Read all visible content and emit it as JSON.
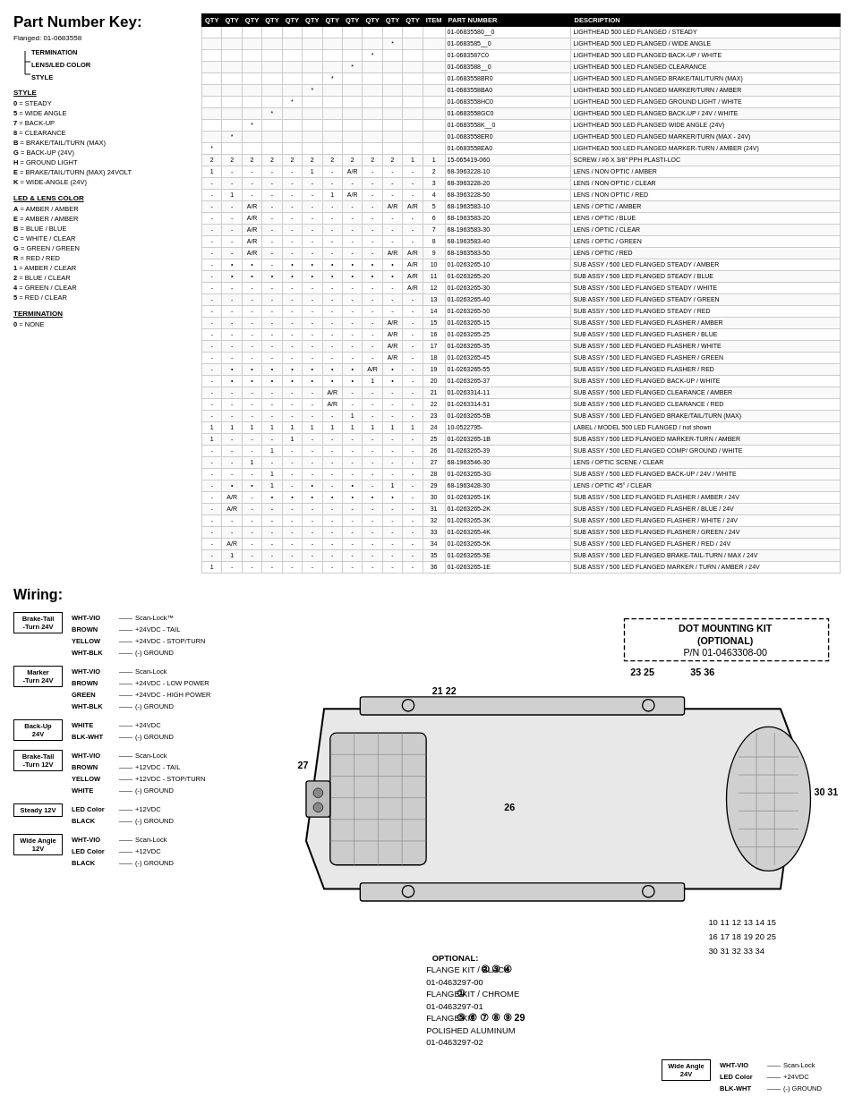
{
  "title": "Part Number Key:",
  "flanged_label": "Flanged:",
  "flanged_pn": "01-0683558",
  "diagram": {
    "termination_label": "TERMINATION",
    "lens_color_label": "LENS/LED COLOR",
    "style_label": "STYLE"
  },
  "style_section": {
    "title": "STYLE",
    "items": [
      {
        "code": "0",
        "desc": "STEADY"
      },
      {
        "code": "5",
        "desc": "WIDE ANGLE"
      },
      {
        "code": "7",
        "desc": "BACK-UP"
      },
      {
        "code": "8",
        "desc": "CLEARANCE"
      },
      {
        "code": "B",
        "desc": "BRAKE/TAIL/TURN (MAX)"
      },
      {
        "code": "G",
        "desc": "BACK-UP (24V)"
      },
      {
        "code": "H",
        "desc": "GROUND LIGHT"
      },
      {
        "code": "E",
        "desc": "BRAKE/TAIL/TURN (MAX) 24VOLT"
      },
      {
        "code": "K",
        "desc": "WIDE-ANGLE (24V)"
      }
    ]
  },
  "led_lens_section": {
    "title": "LED & LENS COLOR",
    "items": [
      {
        "code": "A",
        "desc": "AMBER / AMBER"
      },
      {
        "code": "E",
        "desc": "AMBER / AMBER"
      },
      {
        "code": "B",
        "desc": "BLUE / BLUE"
      },
      {
        "code": "C",
        "desc": "WHITE / CLEAR"
      },
      {
        "code": "G",
        "desc": "GREEN / GREEN"
      },
      {
        "code": "R",
        "desc": "RED / RED"
      },
      {
        "code": "1",
        "desc": "AMBER / CLEAR"
      },
      {
        "code": "2",
        "desc": "BLUE / CLEAR"
      },
      {
        "code": "4",
        "desc": "GREEN / CLEAR"
      },
      {
        "code": "5",
        "desc": "RED / CLEAR"
      }
    ]
  },
  "termination_section": {
    "title": "TERMINATION",
    "items": [
      {
        "code": "0",
        "desc": "NONE"
      }
    ]
  },
  "table": {
    "headers": [
      "QTY",
      "QTY",
      "QTY",
      "QTY",
      "QTY",
      "QTY",
      "QTY",
      "QTY",
      "QTY",
      "QTY",
      "QTY",
      "ITEM",
      "PART NUMBER",
      "DESCRIPTION"
    ],
    "rows": [
      [
        "",
        "",
        "",
        "",
        "",
        "",
        "",
        "",
        "",
        "",
        "",
        "",
        "01-06835580__0",
        "LIGHTHEAD 500 LED FLANGED / STEADY"
      ],
      [
        "",
        "",
        "",
        "",
        "",
        "",
        "",
        "",
        "",
        "*",
        "",
        "",
        "01-0683585__0",
        "LIGHTHEAD 500 LED FLANGED / WIDE ANGLE"
      ],
      [
        "",
        "",
        "",
        "",
        "",
        "",
        "",
        "",
        "*",
        "",
        "",
        "",
        "01-0683587C0",
        "LIGHTHEAD 500 LED FLANGED BACK-UP / WHITE"
      ],
      [
        "",
        "",
        "",
        "",
        "",
        "",
        "",
        "*",
        "",
        "",
        "",
        "",
        "01-0683588__0",
        "LIGHTHEAD 500 LED FLANGED CLEARANCE"
      ],
      [
        "",
        "",
        "",
        "",
        "",
        "",
        "*",
        "",
        "",
        "",
        "",
        "",
        "01-0683558BR0",
        "LIGHTHEAD 500 LED FLANGED BRAKE/TAIL/TURN (MAX)"
      ],
      [
        "",
        "",
        "",
        "",
        "",
        "*",
        "",
        "",
        "",
        "",
        "",
        "",
        "01-0683558BA0",
        "LIGHTHEAD 500 LED FLANGED MARKER/TURN / AMBER"
      ],
      [
        "",
        "",
        "",
        "",
        "*",
        "",
        "",
        "",
        "",
        "",
        "",
        "",
        "01-0683558HC0",
        "LIGHTHEAD 500 LED FLANGED GROUND LIGHT / WHITE"
      ],
      [
        "",
        "",
        "",
        "*",
        "",
        "",
        "",
        "",
        "",
        "",
        "",
        "",
        "01-0683558GC0",
        "LIGHTHEAD 500 LED FLANGED BACK-UP / 24V / WHITE"
      ],
      [
        "",
        "",
        "*",
        "",
        "",
        "",
        "",
        "",
        "",
        "",
        "",
        "",
        "01-0683558K__0",
        "LIGHTHEAD 500 LED FLANGED WIDE ANGLE (24V)"
      ],
      [
        "",
        "*",
        "",
        "",
        "",
        "",
        "",
        "",
        "",
        "",
        "",
        "",
        "01-0683558ER0",
        "LIGHTHEAD 500 LED FLANGED MARKER/TURN (MAX - 24V)"
      ],
      [
        "*",
        "",
        "",
        "",
        "",
        "",
        "",
        "",
        "",
        "",
        "",
        "",
        "01-0683558EA0",
        "LIGHTHEAD 500 LED FLANGED MARKER-TURN / AMBER (24V)"
      ],
      [
        "2",
        "2",
        "2",
        "2",
        "2",
        "2",
        "2",
        "2",
        "2",
        "2",
        "1",
        "1",
        "15-065419-060",
        "SCREW / #6 X 3/8\" PPH PLASTI-LOC"
      ],
      [
        "1",
        "-",
        "-",
        "-",
        "-",
        "1",
        "-",
        "A/R",
        "-",
        "-",
        "-",
        "2",
        "68-3963228-10",
        "LENS / NON OPTIC / AMBER"
      ],
      [
        "-",
        "-",
        "-",
        "-",
        "-",
        "-",
        "-",
        "-",
        "-",
        "-",
        "-",
        "3",
        "68-3963228-20",
        "LENS / NON OPTIC / CLEAR"
      ],
      [
        "-",
        "1",
        "-",
        "-",
        "-",
        "-",
        "1",
        "A/R",
        "-",
        "-",
        "-",
        "4",
        "68-3963228-50",
        "LENS / NON OPTIC / RED"
      ],
      [
        "-",
        "-",
        "A/R",
        "-",
        "-",
        "-",
        "-",
        "-",
        "-",
        "A/R",
        "A/R",
        "5",
        "68-1963583-10",
        "LENS / OPTIC / AMBER"
      ],
      [
        "-",
        "-",
        "A/R",
        "-",
        "-",
        "-",
        "-",
        "-",
        "-",
        "-",
        "-",
        "6",
        "68-1963583-20",
        "LENS / OPTIC / BLUE"
      ],
      [
        "-",
        "-",
        "A/R",
        "-",
        "-",
        "-",
        "-",
        "-",
        "-",
        "-",
        "-",
        "7",
        "68-1963583-30",
        "LENS / OPTIC / CLEAR"
      ],
      [
        "-",
        "-",
        "A/R",
        "-",
        "-",
        "-",
        "-",
        "-",
        "-",
        "-",
        "-",
        "8",
        "68-1963583-40",
        "LENS / OPTIC / GREEN"
      ],
      [
        "-",
        "-",
        "A/R",
        "-",
        "-",
        "-",
        "-",
        "-",
        "-",
        "A/R",
        "A/R",
        "9",
        "68-1963583-50",
        "LENS / OPTIC / RED"
      ],
      [
        "-",
        "•",
        "•",
        "-",
        "•",
        "•",
        "•",
        "•",
        "•",
        "•",
        "A/R",
        "10",
        "01-0263265-10",
        "SUB ASSY / 500 LED FLANGED STEADY / AMBER"
      ],
      [
        "-",
        "•",
        "•",
        "•",
        "•",
        "•",
        "•",
        "•",
        "•",
        "•",
        "A/R",
        "11",
        "01-0263265-20",
        "SUB ASSY / 500 LED FLANGED STEADY / BLUE"
      ],
      [
        "-",
        "-",
        "-",
        "-",
        "-",
        "-",
        "-",
        "-",
        "-",
        "-",
        "A/R",
        "12",
        "01-0263265-30",
        "SUB ASSY / 500 LED FLANGED STEADY / WHITE"
      ],
      [
        "-",
        "-",
        "-",
        "-",
        "-",
        "-",
        "-",
        "-",
        "-",
        "-",
        "-",
        "13",
        "01-0263265-40",
        "SUB ASSY / 500 LED FLANGED STEADY / GREEN"
      ],
      [
        "-",
        "-",
        "-",
        "-",
        "-",
        "-",
        "-",
        "-",
        "-",
        "-",
        "-",
        "14",
        "01-0263265-50",
        "SUB ASSY / 500 LED FLANGED STEADY / RED"
      ],
      [
        "-",
        "-",
        "-",
        "-",
        "-",
        "-",
        "-",
        "-",
        "-",
        "A/R",
        "-",
        "15",
        "01-0263265-15",
        "SUB ASSY / 500 LED FLANGED FLASHER / AMBER"
      ],
      [
        "-",
        "-",
        "-",
        "-",
        "-",
        "-",
        "-",
        "-",
        "-",
        "A/R",
        "-",
        "16",
        "01-0263265-25",
        "SUB ASSY / 500 LED FLANGED FLASHER / BLUE"
      ],
      [
        "-",
        "-",
        "-",
        "-",
        "-",
        "-",
        "-",
        "-",
        "-",
        "A/R",
        "-",
        "17",
        "01-0263265-35",
        "SUB ASSY / 500 LED FLANGED FLASHER / WHITE"
      ],
      [
        "-",
        "-",
        "-",
        "-",
        "-",
        "-",
        "-",
        "-",
        "-",
        "A/R",
        "-",
        "18",
        "01-0263265-45",
        "SUB ASSY / 500 LED FLANGED FLASHER / GREEN"
      ],
      [
        "-",
        "•",
        "•",
        "•",
        "•",
        "•",
        "•",
        "•",
        "A/R",
        "•",
        "-",
        "19",
        "01-0263265-55",
        "SUB ASSY / 500 LED FLANGED FLASHER / RED"
      ],
      [
        "-",
        "•",
        "•",
        "•",
        "•",
        "•",
        "•",
        "•",
        "1",
        "•",
        "-",
        "20",
        "01-0263265-37",
        "SUB ASSY / 500 LED FLANGED BACK-UP / WHITE"
      ],
      [
        "-",
        "-",
        "-",
        "-",
        "-",
        "-",
        "A/R",
        "-",
        "-",
        "-",
        "-",
        "21",
        "01-0263314-11",
        "SUB ASSY / 500 LED FLANGED CLEARANCE / AMBER"
      ],
      [
        "-",
        "-",
        "-",
        "-",
        "-",
        "-",
        "A/R",
        "-",
        "-",
        "-",
        "-",
        "22",
        "01-0263314-51",
        "SUB ASSY / 500 LED FLANGED CLEARANCE / RED"
      ],
      [
        "-",
        "-",
        "-",
        "-",
        "-",
        "-",
        "-",
        "1",
        "-",
        "-",
        "-",
        "23",
        "01-0263265-5B",
        "SUB ASSY / 500 LED FLANGED BRAKE/TAIL/TURN (MAX)"
      ],
      [
        "1",
        "1",
        "1",
        "1",
        "1",
        "1",
        "1",
        "1",
        "1",
        "1",
        "1",
        "24",
        "10-0522795-",
        "LABEL / MODEL 500 LED FLANGED / not shown"
      ],
      [
        "1",
        "-",
        "-",
        "-",
        "1",
        "-",
        "-",
        "-",
        "-",
        "-",
        "-",
        "25",
        "01-0263265-1B",
        "SUB ASSY / 500 LED FLANGED MARKER-TURN / AMBER"
      ],
      [
        "-",
        "-",
        "-",
        "1",
        "-",
        "-",
        "-",
        "-",
        "-",
        "-",
        "-",
        "26",
        "01-0263265-39",
        "SUB ASSY / 500 LED FLANGED COMP/ GROUND / WHITE"
      ],
      [
        "-",
        "-",
        "1",
        "-",
        "-",
        "-",
        "-",
        "-",
        "-",
        "-",
        "-",
        "27",
        "68-1963546-30",
        "LENS / OPTIC SCENE / CLEAR"
      ],
      [
        "-",
        "-",
        "-",
        "1",
        "-",
        "-",
        "-",
        "-",
        "-",
        "-",
        "-",
        "28",
        "01-0263265-3G",
        "SUB ASSY / 500 LED FLANGED BACK-UP / 24V / WHITE"
      ],
      [
        "-",
        "•",
        "•",
        "1",
        "-",
        "•",
        "-",
        "•",
        "-",
        "1",
        "-",
        "29",
        "68-1963428-30",
        "LENS / OPTIC 45° / CLEAR"
      ],
      [
        "-",
        "A/R",
        "-",
        "•",
        "•",
        "•",
        "•",
        "•",
        "•",
        "•",
        "-",
        "30",
        "01-0263265-1K",
        "SUB ASSY / 500 LED FLANGED FLASHER / AMBER / 24V"
      ],
      [
        "-",
        "A/R",
        "-",
        "-",
        "-",
        "-",
        "-",
        "-",
        "-",
        "-",
        "-",
        "31",
        "01-0263265-2K",
        "SUB ASSY / 500 LED FLANGED FLASHER / BLUE / 24V"
      ],
      [
        "-",
        "-",
        "-",
        "-",
        "-",
        "-",
        "-",
        "-",
        "-",
        "-",
        "-",
        "32",
        "01-0263265-3K",
        "SUB ASSY / 500 LED FLANGED FLASHER / WHITE / 24V"
      ],
      [
        "-",
        "-",
        "-",
        "-",
        "-",
        "-",
        "-",
        "-",
        "-",
        "-",
        "-",
        "33",
        "01-0263265-4K",
        "SUB ASSY / 500 LED FLANGED FLASHER / GREEN / 24V"
      ],
      [
        "-",
        "A/R",
        "-",
        "-",
        "-",
        "-",
        "-",
        "-",
        "-",
        "-",
        "-",
        "34",
        "01-0263265-5K",
        "SUB ASSY / 500 LED FLANGED FLASHER / RED / 24V"
      ],
      [
        "-",
        "1",
        "-",
        "-",
        "-",
        "-",
        "-",
        "-",
        "-",
        "-",
        "-",
        "35",
        "01-0263265-5E",
        "SUB ASSY / 500 LED FLANGED BRAKE-TAIL-TURN / MAX / 24V"
      ],
      [
        "1",
        "-",
        "-",
        "-",
        "-",
        "-",
        "-",
        "-",
        "-",
        "-",
        "-",
        "36",
        "01-0263265-1E",
        "SUB ASSY / 500 LED FLANGED MARKER / TURN / AMBER / 24V"
      ]
    ]
  },
  "wiring": {
    "title": "Wiring:",
    "blocks": [
      {
        "id": "brake-tail-turn-24v",
        "title": "Brake-Tail\n-Turn 24V",
        "lines": [
          {
            "color": "WHT-VIO",
            "dash": "———",
            "desc": "Scan-Lock™"
          },
          {
            "color": "BROWN",
            "dash": "———",
            "desc": "+24VDC - TAIL"
          },
          {
            "color": "YELLOW",
            "dash": "———",
            "desc": "+24VDC - STOP/TURN"
          },
          {
            "color": "WHT-BLK",
            "dash": "———",
            "desc": "(-) GROUND"
          }
        ]
      },
      {
        "id": "marker-turn-24v",
        "title": "Marker\n-Turn 24V",
        "lines": [
          {
            "color": "WHT-VIO",
            "dash": "———",
            "desc": "Scan-Lock"
          },
          {
            "color": "BROWN",
            "dash": "———",
            "desc": "+24VDC - LOW POWER"
          },
          {
            "color": "GREEN",
            "dash": "———",
            "desc": "+24VDC - HIGH POWER"
          },
          {
            "color": "WHT-BLK",
            "dash": "———",
            "desc": "(-) GROUND"
          }
        ]
      },
      {
        "id": "back-up-24v",
        "title": "Back-Up\n24V",
        "lines": [
          {
            "color": "WHITE",
            "dash": "———",
            "desc": "+24VDC"
          },
          {
            "color": "BLK-WHT",
            "dash": "———",
            "desc": "(-) GROUND"
          }
        ]
      },
      {
        "id": "brake-tail-turn-12v",
        "title": "Brake-Tail\n-Turn 12V",
        "lines": [
          {
            "color": "WHT-VIO",
            "dash": "———",
            "desc": "Scan-Lock"
          },
          {
            "color": "BROWN",
            "dash": "———",
            "desc": "+12VDC - TAIL"
          },
          {
            "color": "YELLOW",
            "dash": "———",
            "desc": "+12VDC - STOP/TURN"
          },
          {
            "color": "WHITE",
            "dash": "———",
            "desc": "(-) GROUND"
          }
        ]
      },
      {
        "id": "steady-12v",
        "title": "Steady 12V",
        "lines": [
          {
            "color": "LED Color",
            "dash": "———",
            "desc": "+12VDC"
          },
          {
            "color": "BLACK",
            "dash": "———",
            "desc": "(-) GROUND"
          }
        ]
      },
      {
        "id": "wide-angle-12v",
        "title": "Wide Angle\n12V",
        "lines": [
          {
            "color": "WHT-VIO",
            "dash": "———",
            "desc": "Scan-Lock"
          },
          {
            "color": "LED Color",
            "dash": "———",
            "desc": "+12VDC"
          },
          {
            "color": "BLACK",
            "dash": "———",
            "desc": "(-) GROUND"
          }
        ]
      }
    ],
    "right_blocks": [
      {
        "id": "wide-angle-24v",
        "title": "Wide Angle\n24V",
        "lines": [
          {
            "color": "WHT-VIO",
            "dash": "———",
            "desc": "Scan-Lock"
          },
          {
            "color": "LED Color",
            "dash": "———",
            "desc": "+24VDC"
          },
          {
            "color": "BLK-WHT",
            "dash": "———",
            "desc": "(-) GROUND"
          }
        ]
      }
    ],
    "optional_flange": {
      "title": "OPTIONAL:",
      "items": [
        {
          "label": "FLANGE KIT / BLACK"
        },
        {
          "label": "01-0463297-00"
        },
        {
          "label": "FLANGE KIT / CHROME"
        },
        {
          "label": "01-0463297-01"
        },
        {
          "label": "FLANGE KIT"
        },
        {
          "label": "POLISHED ALUMINUM"
        },
        {
          "label": "01-0463297-02"
        }
      ]
    },
    "dot_kit": {
      "title": "DOT MOUNTING KIT\n(OPTIONAL)",
      "pn": "P/N 01-0463308-00"
    }
  }
}
